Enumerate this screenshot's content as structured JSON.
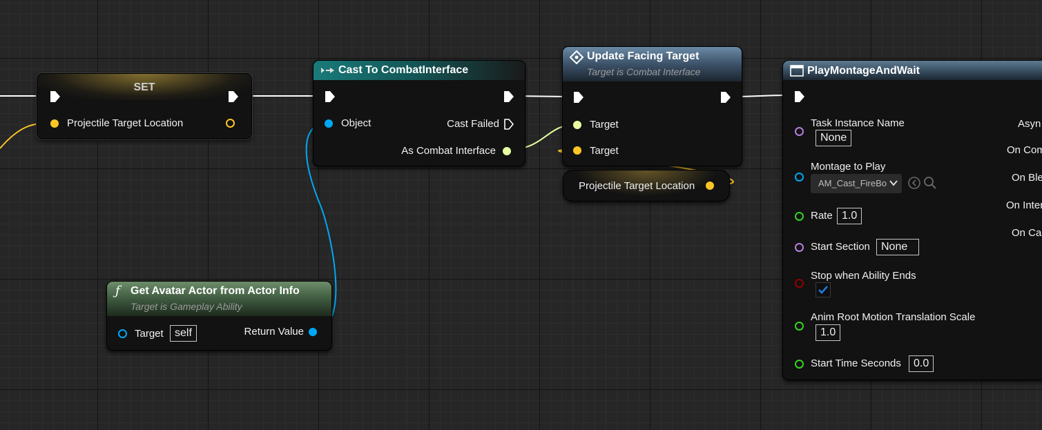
{
  "colors": {
    "exec": "#ffffff",
    "vector": "#fdc624",
    "object": "#00a8f4",
    "interface": "#e7ffa0",
    "name": "#b67fe0",
    "float": "#35d321",
    "bool": "#920101"
  },
  "set_node": {
    "title": "SET",
    "pin_label": "Projectile Target Location"
  },
  "cast_node": {
    "title": "Cast To CombatInterface",
    "object_label": "Object",
    "cast_failed_label": "Cast Failed",
    "output_label": "As Combat Interface"
  },
  "update_node": {
    "title": "Update Facing Target",
    "subtitle": "Target is Combat Interface",
    "target1_label": "Target",
    "target2_label": "Target"
  },
  "var_node": {
    "label": "Projectile Target Location"
  },
  "avatar_node": {
    "title": "Get Avatar Actor from Actor Info",
    "subtitle": "Target is Gameplay Ability",
    "target_label": "Target",
    "target_value": "self",
    "return_label": "Return Value"
  },
  "montage_node": {
    "title": "PlayMontageAndWait",
    "task_instance_label": "Task Instance Name",
    "task_instance_value": "None",
    "montage_label": "Montage to Play",
    "montage_value": "AM_Cast_FireBo",
    "rate_label": "Rate",
    "rate_value": "1.0",
    "start_section_label": "Start Section",
    "start_section_value": "None",
    "stop_label": "Stop when Ability Ends",
    "stop_checked": true,
    "root_motion_label": "Anim Root Motion Translation Scale",
    "root_motion_value": "1.0",
    "start_time_label": "Start Time Seconds",
    "start_time_value": "0.0",
    "outputs": [
      "Asyn",
      "On Com",
      "On Ble",
      "On Inter",
      "On Car"
    ]
  },
  "icons": {
    "function": "function-icon",
    "cast": "cast-icon",
    "event": "event-diamond-icon",
    "task": "task-icon",
    "browse": "browse-arrow-icon",
    "search": "search-icon",
    "dropdown": "chevron-down-icon",
    "checkbox": "checkmark-icon"
  }
}
